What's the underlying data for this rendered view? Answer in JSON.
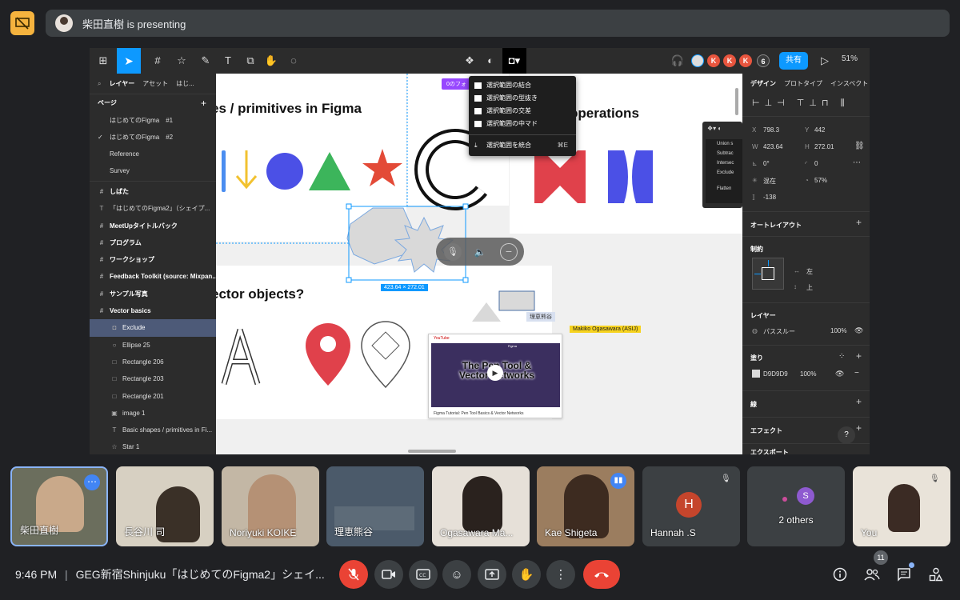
{
  "meeting": {
    "presenting_text": "柴田直樹 is presenting",
    "clock": "9:46 PM",
    "title": "GEG新宿Shinjuku「はじめてのFigma2」シェイ...",
    "people_count": "11"
  },
  "figma": {
    "zoom": "51%",
    "share_label": "共有",
    "collaborators": [
      "K",
      "K",
      "K",
      "6"
    ],
    "left_tabs": [
      "レイヤー",
      "アセット",
      "はじ..."
    ],
    "pages_heading": "ページ",
    "pages": [
      "はじめてのFigma　#1",
      "はじめてのFigma　#2",
      "Reference",
      "Survey"
    ],
    "layers": [
      {
        "label": "しばた",
        "icon": "#"
      },
      {
        "label": "「はじめてのFigma2」（シェイプ...",
        "icon": "T"
      },
      {
        "label": "MeetUpタイトルバック",
        "icon": "#"
      },
      {
        "label": "プログラム",
        "icon": "#"
      },
      {
        "label": "ワークショップ",
        "icon": "#"
      },
      {
        "label": "Feedback Toolkit (source: Mixpan...",
        "icon": "#"
      },
      {
        "label": "サンプル写真",
        "icon": "#"
      },
      {
        "label": "Vector basics",
        "icon": "#"
      },
      {
        "label": "Exclude",
        "icon": "◘"
      },
      {
        "label": "Ellipse 25",
        "icon": "○"
      },
      {
        "label": "Rectangle 206",
        "icon": "□"
      },
      {
        "label": "Rectangle 203",
        "icon": "□"
      },
      {
        "label": "Rectangle 201",
        "icon": "□"
      },
      {
        "label": "image 1",
        "icon": "▣"
      },
      {
        "label": "Basic shapes / primitives in Fi...",
        "icon": "T"
      },
      {
        "label": "Star 1",
        "icon": "☆"
      }
    ],
    "right_tabs": [
      "デザイン",
      "プロトタイプ",
      "インスペクト"
    ],
    "props": {
      "x_label": "X",
      "x": "798.3",
      "y_label": "Y",
      "y": "442",
      "w_label": "W",
      "w": "423.64",
      "h_label": "H",
      "h": "272.01",
      "rotation": "0°",
      "radius": "0",
      "blend_label": "混在",
      "opacity": "57%",
      "angle": "-138"
    },
    "sections": {
      "auto_layout": "オートレイアウト",
      "constraints": "制約",
      "constraint_h": "左",
      "constraint_v": "上",
      "layer": "レイヤー",
      "layer_mode": "パススルー",
      "layer_opacity": "100%",
      "fill": "塗り",
      "fill_hex": "D9D9D9",
      "fill_opacity": "100%",
      "stroke": "線",
      "effects": "エフェクト",
      "export": "エクスポート"
    },
    "bool_menu": [
      "選択範囲の結合",
      "選択範囲の型抜き",
      "選択範囲の交差",
      "選択範囲の中マド",
      "選択範囲を統合"
    ],
    "bool_menu_shortcut": "⌘E",
    "bool_mini_menu": [
      "Union s",
      "Subtrac",
      "Intersec",
      "Exclude",
      "Flatten"
    ],
    "canvas": {
      "title1": "es / primitives in Figma",
      "title2": "operations",
      "title3": "ector objects?",
      "dimension_tag": "423.64 × 272.01",
      "frame_tag": "0のフォ",
      "cursor_name1": "理恵熊谷",
      "cursor_name2": "Makiko Ogasawara (ASIJ)",
      "video_title": "The Pen Tool & Vector Networks",
      "video_caption": "Figma Tutorial: Pen Tool Basics & Vector Networks",
      "video_source": "YouTube",
      "video_brand": "Figma"
    }
  },
  "participants": [
    {
      "name": "柴田直樹"
    },
    {
      "name": "長谷川 司"
    },
    {
      "name": "Noriyuki KOIKE"
    },
    {
      "name": "理恵熊谷"
    },
    {
      "name": "Ogasawara Ma..."
    },
    {
      "name": "Kae Shigeta"
    },
    {
      "name": "Hannah .S",
      "initial": "H"
    },
    {
      "name": "2 others",
      "initial": "S"
    },
    {
      "name": "You"
    }
  ],
  "colors": {
    "accent_blue": "#0d99ff",
    "end_call_red": "#ea4335",
    "present_yellow": "#f5b33e"
  }
}
